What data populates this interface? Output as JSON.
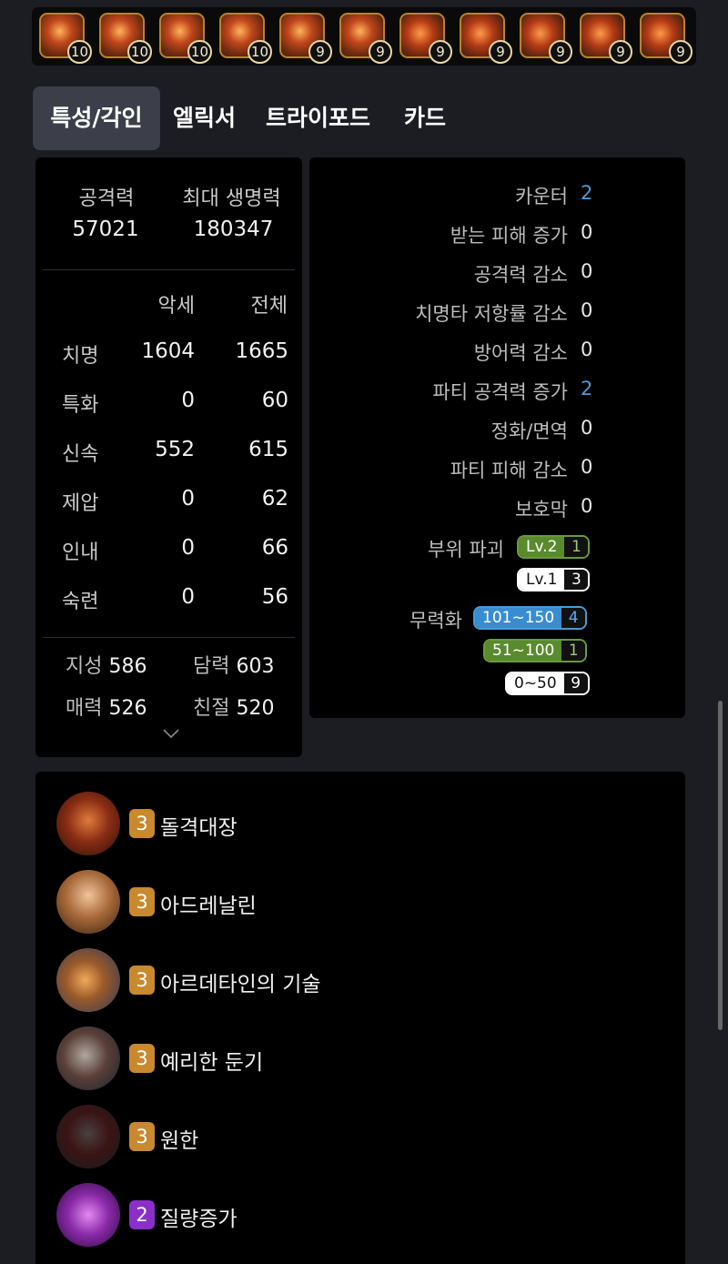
{
  "gems": [
    {
      "level": "10",
      "icon": "flame-gem-icon"
    },
    {
      "level": "10",
      "icon": "flame-gem-icon"
    },
    {
      "level": "10",
      "icon": "flame-gem-icon"
    },
    {
      "level": "10",
      "icon": "flame-gem-icon"
    },
    {
      "level": "9",
      "icon": "flame-gem-icon"
    },
    {
      "level": "9",
      "icon": "flame-gem-icon"
    },
    {
      "level": "9",
      "icon": "orb-gem-icon"
    },
    {
      "level": "9",
      "icon": "orb-gem-icon"
    },
    {
      "level": "9",
      "icon": "orb-gem-icon"
    },
    {
      "level": "9",
      "icon": "orb-gem-icon"
    },
    {
      "level": "9",
      "icon": "orb-gem-icon"
    }
  ],
  "tabs": [
    "특성/각인",
    "엘릭서",
    "트라이포드",
    "카드"
  ],
  "active_tab": "특성/각인",
  "stats": {
    "attack_label": "공격력",
    "attack_value": "57021",
    "hp_label": "최대 생명력",
    "hp_value": "180347",
    "col_acc": "악세",
    "col_total": "전체",
    "rows": [
      {
        "name": "치명",
        "acc": "1604",
        "total": "1665"
      },
      {
        "name": "특화",
        "acc": "0",
        "total": "60"
      },
      {
        "name": "신속",
        "acc": "552",
        "total": "615"
      },
      {
        "name": "제압",
        "acc": "0",
        "total": "62"
      },
      {
        "name": "인내",
        "acc": "0",
        "total": "66"
      },
      {
        "name": "숙련",
        "acc": "0",
        "total": "56"
      }
    ],
    "traits": [
      {
        "name": "지성",
        "value": "586"
      },
      {
        "name": "담력",
        "value": "603"
      },
      {
        "name": "매력",
        "value": "526"
      },
      {
        "name": "친절",
        "value": "520"
      }
    ]
  },
  "synergy": {
    "rows": [
      {
        "label": "카운터",
        "value": "2"
      },
      {
        "label": "받는 피해 증가",
        "value": "0"
      },
      {
        "label": "공격력 감소",
        "value": "0"
      },
      {
        "label": "치명타 저항률 감소",
        "value": "0"
      },
      {
        "label": "방어력 감소",
        "value": "0"
      },
      {
        "label": "파티 공격력 증가",
        "value": "2"
      },
      {
        "label": "정화/면역",
        "value": "0"
      },
      {
        "label": "파티 피해 감소",
        "value": "0"
      },
      {
        "label": "보호막",
        "value": "0"
      }
    ],
    "part_break": {
      "label": "부위 파괴",
      "pills": [
        {
          "text": "Lv.2",
          "count": "1"
        },
        {
          "text": "Lv.1",
          "count": "3"
        }
      ]
    },
    "stagger": {
      "label": "무력화",
      "pills": [
        {
          "text": "101~150",
          "count": "4"
        },
        {
          "text": "51~100",
          "count": "1"
        },
        {
          "text": "0~50",
          "count": "9"
        }
      ]
    }
  },
  "engravings": [
    {
      "level": "3",
      "name": "돌격대장"
    },
    {
      "level": "3",
      "name": "아드레날린"
    },
    {
      "level": "3",
      "name": "아르데타인의 기술"
    },
    {
      "level": "3",
      "name": "예리한 둔기"
    },
    {
      "level": "3",
      "name": "원한"
    },
    {
      "level": "2",
      "name": "질량증가"
    }
  ],
  "colors": {
    "highlight_value": "#4f9bd9",
    "engraving_level3": "#c8892f",
    "engraving_level2": "#8b2fc9"
  }
}
